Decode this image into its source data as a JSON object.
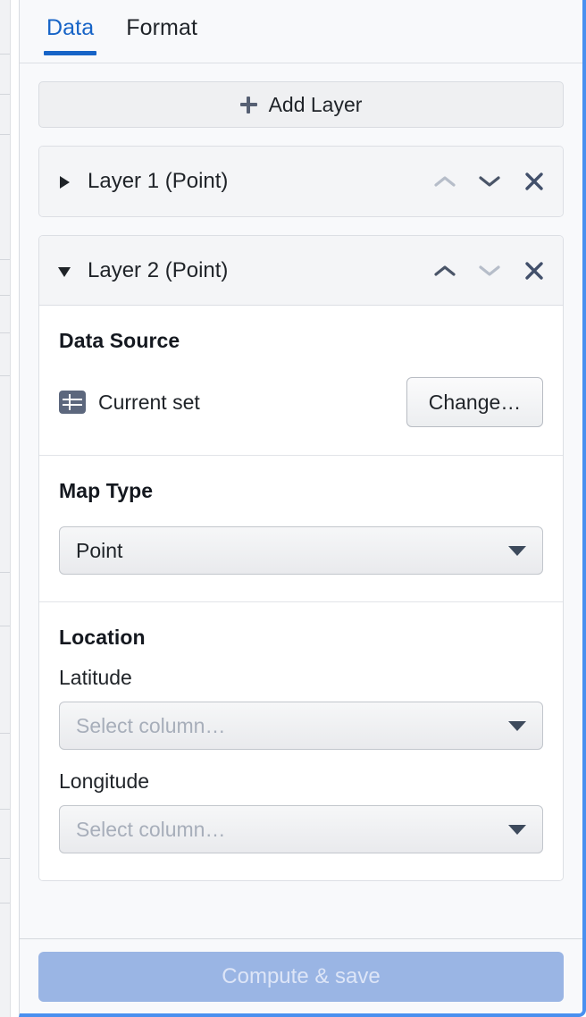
{
  "panel": {
    "accent_color": "#4a90ef",
    "background": "#f8f9fb"
  },
  "tabs": [
    {
      "label": "Data",
      "active": true
    },
    {
      "label": "Format",
      "active": false
    }
  ],
  "toolbar": {
    "add_layer_label": "Add Layer",
    "add_layer_icon": "plus-icon"
  },
  "layers": [
    {
      "title": "Layer 1 (Point)",
      "expanded": false,
      "disclosure_icon": "triangle-right-icon",
      "move_up_enabled": false,
      "move_down_enabled": true
    },
    {
      "title": "Layer 2 (Point)",
      "expanded": true,
      "disclosure_icon": "triangle-down-icon",
      "move_up_enabled": true,
      "move_down_enabled": false,
      "sections": {
        "data_source": {
          "title": "Data Source",
          "source_icon": "table-icon",
          "source_name": "Current set",
          "change_button_label": "Change…"
        },
        "map_type": {
          "title": "Map Type",
          "value": "Point"
        },
        "location": {
          "title": "Location",
          "latitude_label": "Latitude",
          "latitude_value": "Select column…",
          "latitude_is_placeholder": true,
          "longitude_label": "Longitude",
          "longitude_value": "Select column…",
          "longitude_is_placeholder": true
        }
      }
    }
  ],
  "icons": {
    "move_up": "chevron-up-icon",
    "move_down": "chevron-down-icon",
    "remove": "close-icon",
    "dropdown": "caret-down-icon"
  },
  "footer": {
    "primary_label": "Compute & save",
    "primary_disabled": true,
    "primary_color": "#9ab5e4"
  }
}
